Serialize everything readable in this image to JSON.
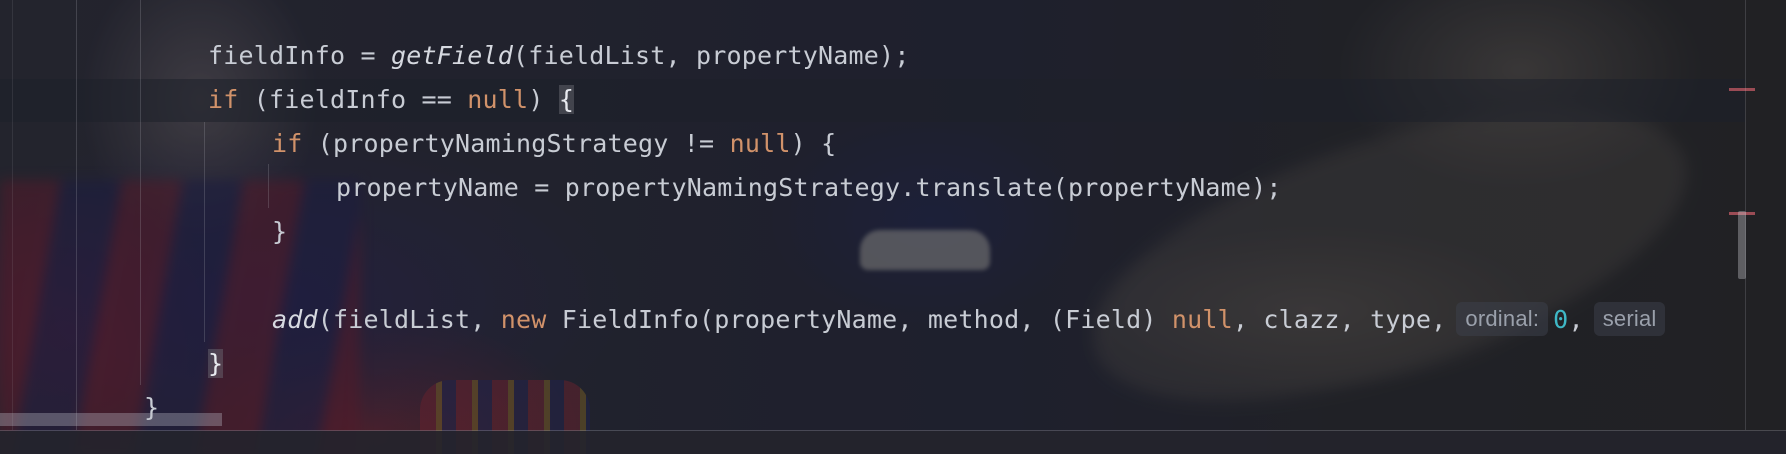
{
  "editor": {
    "lines": [
      {
        "indent": "fieldInfo = ",
        "call": "getField",
        "rest": "(fieldList, propertyName);"
      },
      {
        "kw1": "if",
        "mid": " (fieldInfo == ",
        "kw2": "null",
        "end": ") ",
        "brace": "{"
      },
      {
        "kw1": "if",
        "mid": " (propertyNamingStrategy != ",
        "kw2": "null",
        "end": ") {"
      },
      {
        "text": "propertyName = propertyNamingStrategy.translate(propertyName);"
      },
      {
        "text": "}"
      },
      {
        "call": "add",
        "a": "(fieldList, ",
        "kw": "new",
        "b": " FieldInfo(propertyName, method, (Field) ",
        "kw2": "null",
        "c": ", clazz, type,",
        "hint1": "ordinal:",
        "num1": "0",
        "comma": ",",
        "hint2": "serial"
      },
      {
        "text": "}"
      },
      {
        "text": "}"
      }
    ]
  }
}
